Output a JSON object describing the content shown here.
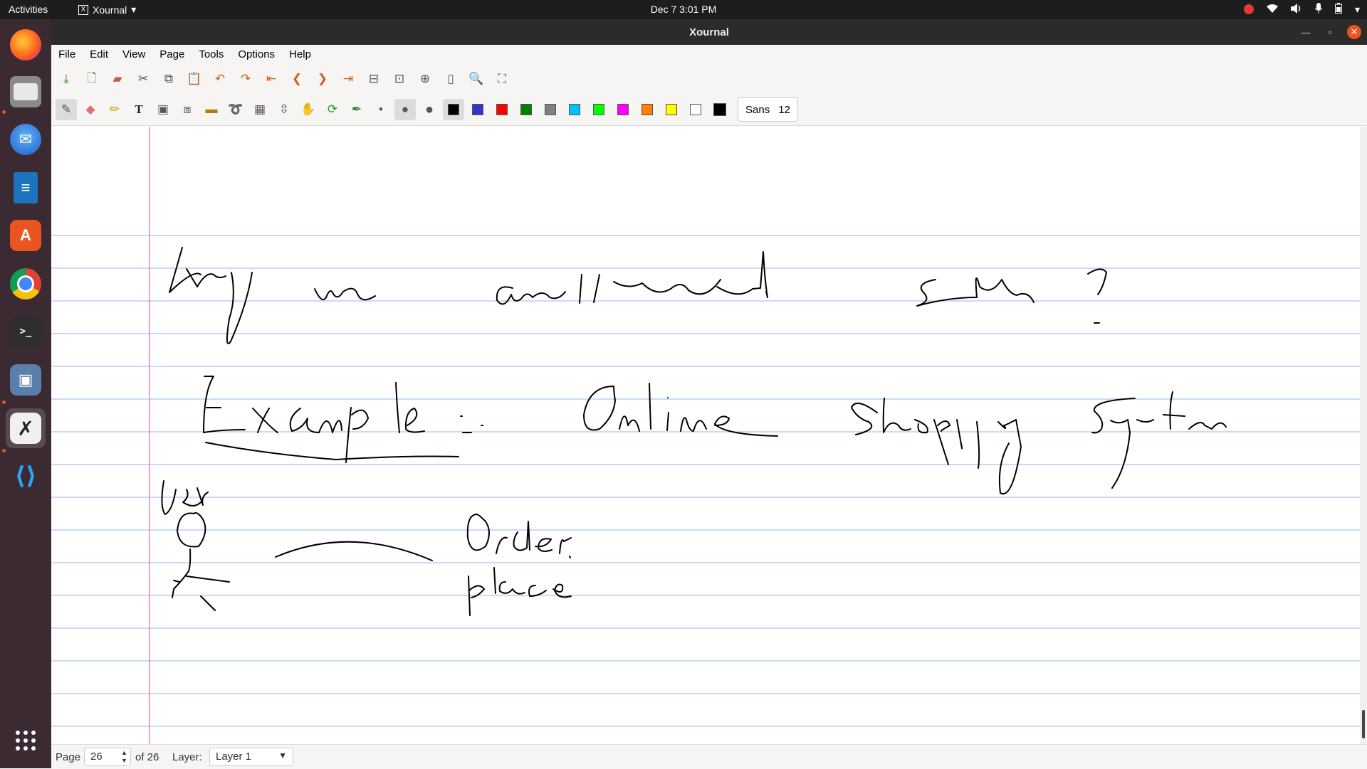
{
  "topbar": {
    "activities": "Activities",
    "app_name": "Xournal",
    "app_icon": "X",
    "clock": "Dec 7  3:01 PM",
    "tray_icons": [
      "record-icon",
      "wifi-icon",
      "volume-icon",
      "mic-icon",
      "battery-icon",
      "chevron-down-icon"
    ]
  },
  "dock": {
    "items": [
      "firefox",
      "files",
      "thunderbird",
      "writer",
      "software",
      "chrome",
      "terminal",
      "screenshot",
      "xournal",
      "vscode",
      "app-grid"
    ]
  },
  "window": {
    "title": "Xournal"
  },
  "menu": {
    "file": "File",
    "edit": "Edit",
    "view": "View",
    "page": "Page",
    "tools": "Tools",
    "options": "Options",
    "help": "Help"
  },
  "toolbar": {
    "font_name": "Sans",
    "font_size": "12",
    "colors": [
      "#000000",
      "#3333cc",
      "#ff0000",
      "#008000",
      "#808080",
      "#00c0ff",
      "#00ff00",
      "#ff00ff",
      "#ff8000",
      "#ffff00",
      "#ffffff",
      "#000000"
    ]
  },
  "paper": {
    "rule_color": "#a8c8f0",
    "margin_color": "#ff5fa0",
    "ink_color": "#000000"
  },
  "status": {
    "page_label": "Page",
    "page_value": "26",
    "of_label": "of 26",
    "layer_label": "Layer:",
    "layer_value": "Layer 1"
  }
}
